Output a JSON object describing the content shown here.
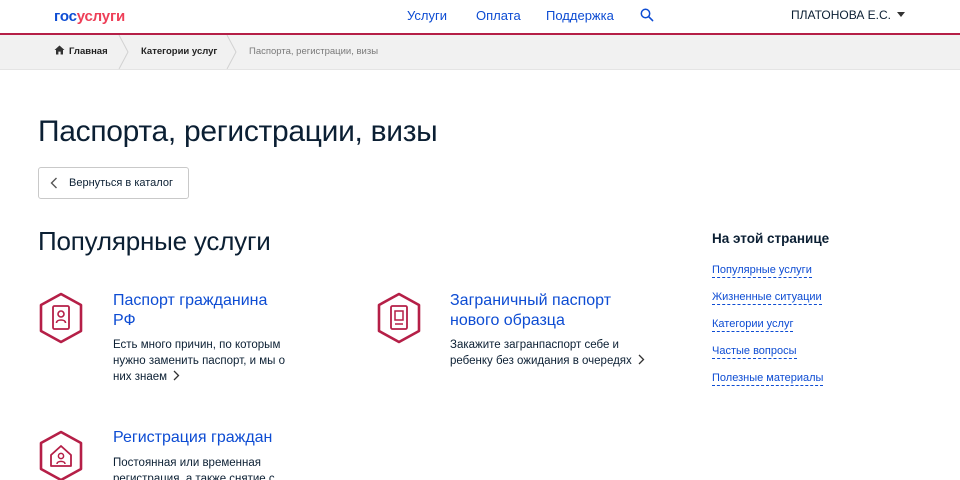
{
  "header": {
    "logo_part1": "гос",
    "logo_part2": "услуги",
    "nav": [
      "Услуги",
      "Оплата",
      "Поддержка"
    ],
    "user_name": "ПЛАТОНОВА Е.С.",
    "accent_color": "#b51f47",
    "link_color": "#0d4cd3"
  },
  "breadcrumbs": {
    "home": "Главная",
    "category": "Категории услуг",
    "current": "Паспорта, регистрации, визы"
  },
  "page": {
    "title": "Паспорта, регистрации, визы",
    "back_button": "Вернуться в каталог",
    "section_title": "Популярные услуги"
  },
  "services": [
    {
      "title_line1": "Паспорт гражданина",
      "title_line2": "РФ",
      "desc_line1": "Есть много причин, по которым",
      "desc_line2": "нужно заменить паспорт, и мы о",
      "desc_line3": "них знаем",
      "icon": "passport-person-icon"
    },
    {
      "title_line1": "Заграничный паспорт",
      "title_line2": "нового образца",
      "desc_line1": "Закажите загранпаспорт себе и",
      "desc_line2": "ребенку без ожидания в очередях",
      "icon": "foreign-passport-icon"
    },
    {
      "title_line1": "Регистрация граждан",
      "desc_line1": "Постоянная или временная",
      "desc_line2": "регистрация, а также снятие с",
      "icon": "house-person-icon"
    }
  ],
  "toc": {
    "title": "На этой странице",
    "links": [
      "Популярные услуги",
      "Жизненные ситуации",
      "Категории услуг",
      "Частые вопросы",
      "Полезные материалы"
    ]
  }
}
